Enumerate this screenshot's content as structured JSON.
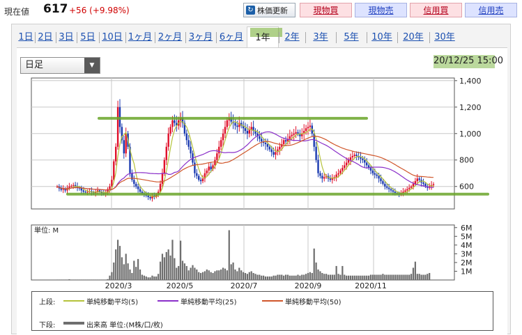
{
  "header": {
    "price_label": "現在値",
    "price_value": "617",
    "price_change": "+56 (+9.98%)",
    "update_button": "株価更新",
    "trade_buttons": [
      "現物買",
      "現物売",
      "信用買",
      "信用売"
    ]
  },
  "tabs": [
    "1日",
    "2日",
    "3日",
    "5日",
    "10日",
    "1ヶ月",
    "2ヶ月",
    "3ヶ月",
    "6ヶ月",
    "1年",
    "2年",
    "3年",
    "5年",
    "10年",
    "20年",
    "30年"
  ],
  "active_tab": "1年",
  "selector": {
    "value": "日足"
  },
  "datetime": "20/12/25 15:00",
  "colors": {
    "up_candle": "#e0102a",
    "down_candle": "#1a3ab0",
    "ma5": "#b5c23a",
    "ma25": "#8a2fc9",
    "ma50": "#d0562a",
    "volume": "#6e6e6e",
    "annotation": "#6aa52a"
  },
  "chart_data": [
    {
      "type": "candlestick",
      "x_tick_labels": [
        "2020/3",
        "2020/5",
        "2020/7",
        "2020/9",
        "2020/11"
      ],
      "yticks": [
        600,
        800,
        "1,000",
        "1,200",
        "1,400"
      ],
      "ylim": [
        430,
        1420
      ],
      "close_series": [
        600,
        585,
        575,
        580,
        570,
        590,
        600,
        605,
        610,
        600,
        590,
        585,
        570,
        560,
        555,
        560,
        565,
        555,
        550,
        560,
        570,
        560,
        550,
        545,
        550,
        580,
        600,
        650,
        790,
        900,
        1200,
        1050,
        950,
        850,
        1000,
        900,
        700,
        650,
        620,
        600,
        580,
        560,
        545,
        540,
        530,
        520,
        510,
        530,
        520,
        540,
        560,
        620,
        700,
        800,
        900,
        1000,
        1050,
        1100,
        1080,
        1060,
        1100,
        1120,
        1080,
        1000,
        950,
        900,
        850,
        780,
        700,
        680,
        650,
        640,
        660,
        700,
        720,
        750,
        730,
        760,
        800,
        850,
        900,
        950,
        1000,
        1050,
        1100,
        1120,
        1090,
        1080,
        1060,
        1050,
        1080,
        1060,
        1040,
        1020,
        1000,
        1030,
        1050,
        1020,
        1000,
        980,
        960,
        940,
        930,
        920,
        900,
        880,
        860,
        840,
        860,
        880,
        900,
        920,
        950,
        940,
        960,
        980,
        990,
        1000,
        1010,
        1000,
        980,
        1000,
        1020,
        1040,
        1050,
        1060,
        1000,
        900,
        800,
        700,
        680,
        660,
        670,
        680,
        660,
        650,
        660,
        670,
        690,
        700,
        720,
        740,
        760,
        780,
        800,
        820,
        830,
        840,
        830,
        820,
        810,
        800,
        780,
        760,
        740,
        720,
        700,
        690,
        680,
        660,
        640,
        620,
        600,
        590,
        580,
        570,
        560,
        550,
        545,
        540,
        550,
        560,
        570,
        580,
        590,
        600,
        620,
        640,
        660,
        650,
        630,
        620,
        600,
        590,
        600,
        610,
        617
      ],
      "volume_yticks": [
        "1M",
        "2M",
        "3M",
        "4M",
        "5M",
        "6M"
      ],
      "volume_ylim": [
        0,
        6.3
      ],
      "volume_unit_label": "単位: M",
      "volume_values": [
        0.05,
        0.05,
        0.05,
        0.05,
        0.05,
        0.05,
        0.08,
        0.05,
        0.05,
        0.05,
        0.05,
        0.05,
        0.05,
        0.05,
        0.05,
        0.05,
        0.05,
        0.05,
        0.05,
        0.05,
        0.05,
        0.05,
        0.05,
        0.05,
        0.05,
        0.1,
        0.5,
        0.9,
        2.0,
        3.5,
        4.6,
        3.9,
        2.6,
        1.8,
        3.0,
        1.9,
        1.2,
        0.8,
        2.2,
        1.5,
        2.4,
        1.2,
        0.6,
        0.5,
        0.4,
        0.3,
        0.3,
        0.5,
        0.4,
        0.4,
        0.7,
        2.1,
        3.0,
        2.6,
        3.2,
        3.5,
        2.8,
        4.6,
        2.5,
        1.4,
        1.6,
        4.5,
        2.2,
        1.9,
        1.6,
        1.1,
        1.4,
        1.7,
        1.4,
        1.2,
        0.9,
        0.8,
        0.9,
        1.0,
        1.2,
        1.1,
        0.9,
        0.8,
        1.0,
        1.1,
        1.1,
        1.2,
        1.4,
        1.3,
        1.1,
        5.7,
        1.8,
        2.0,
        1.2,
        1.0,
        1.4,
        1.1,
        0.9,
        0.8,
        0.7,
        0.9,
        1.0,
        0.8,
        0.7,
        0.6,
        0.6,
        0.5,
        0.5,
        0.4,
        0.4,
        0.4,
        0.4,
        0.5,
        0.5,
        0.6,
        0.6,
        0.6,
        0.5,
        0.6,
        0.6,
        0.5,
        0.5,
        0.5,
        0.5,
        0.6,
        0.5,
        0.6,
        0.6,
        0.7,
        0.8,
        0.9,
        0.8,
        3.6,
        2.0,
        1.2,
        1.0,
        0.8,
        0.7,
        0.7,
        0.6,
        0.6,
        0.6,
        0.6,
        1.6,
        0.7,
        0.6,
        1.6,
        0.6,
        0.5,
        0.5,
        0.5,
        0.5,
        0.5,
        0.5,
        0.5,
        0.5,
        0.5,
        0.5,
        0.5,
        0.5,
        0.6,
        0.6,
        0.6,
        0.6,
        0.6,
        0.6,
        0.7,
        0.6,
        0.6,
        0.6,
        0.6,
        0.6,
        0.6,
        0.6,
        0.6,
        0.6,
        0.6,
        0.6,
        0.6,
        0.6,
        0.7,
        1.4,
        2.1,
        0.7,
        0.7,
        0.6,
        0.6,
        0.6,
        0.7,
        0.8
      ]
    }
  ],
  "legend": {
    "upper_label": "上段:",
    "lower_label": "下段:",
    "ma5": "単純移動平均(5)",
    "ma25": "単純移動平均(25)",
    "ma50": "単純移動平均(50)",
    "volume": "出来高 単位:(M株/口/枚)"
  }
}
